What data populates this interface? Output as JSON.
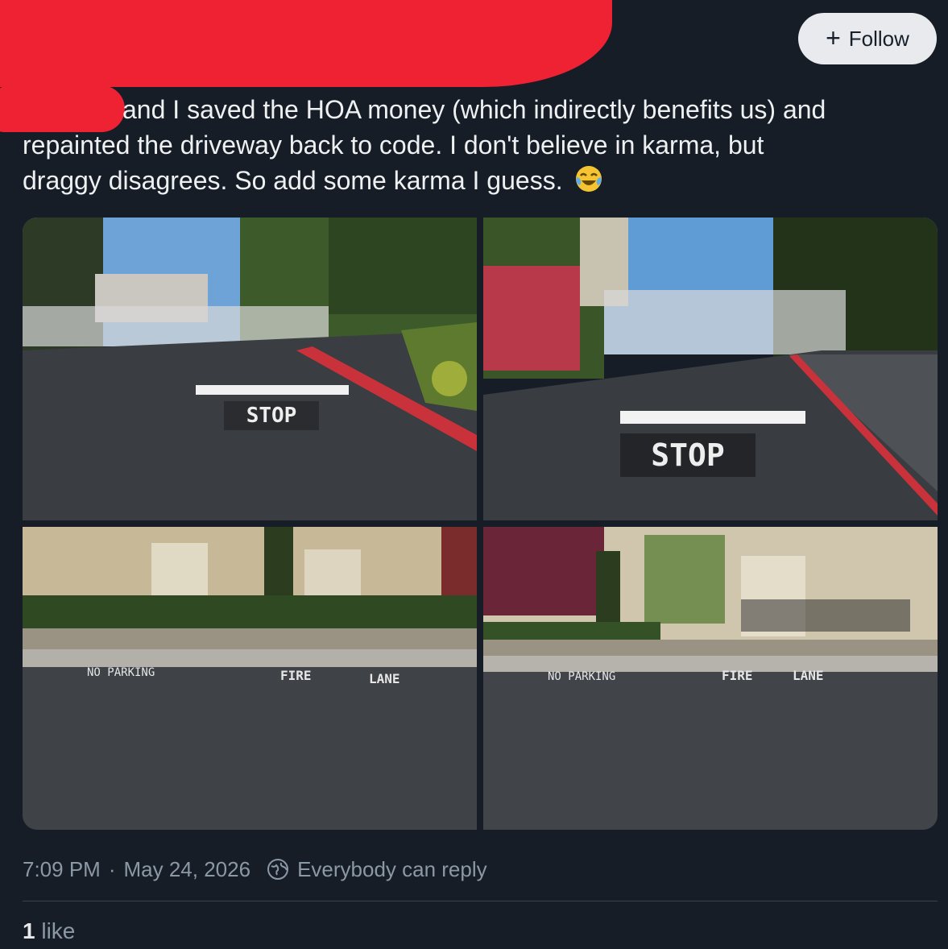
{
  "header": {
    "follow_label": "Follow"
  },
  "post": {
    "text_line1": "and I saved the HOA money (which indirectly benefits us) and",
    "text_line2": "repainted the driveway back to code. I don't believe in karma, but",
    "text_line3": "draggy disagrees. So add some karma I guess.",
    "emoji": "face-with-tears-of-joy",
    "images": [
      {
        "road_text": "STOP"
      },
      {
        "road_text": "STOP"
      },
      {
        "road_text_left": "NO PARKING",
        "road_text_mid": "FIRE",
        "road_text_right": "LANE"
      },
      {
        "road_text_left": "NO PARKING",
        "road_text_mid": "FIRE",
        "road_text_right": "LANE"
      }
    ]
  },
  "meta": {
    "time": "7:09 PM",
    "separator": "·",
    "date": "May 24, 2026",
    "reply_setting": "Everybody can reply"
  },
  "stats": {
    "like_count": "1",
    "like_label": "like"
  },
  "colors": {
    "background": "#161d27",
    "redaction": "#ee2233",
    "follow_bg": "#e8eaed"
  }
}
